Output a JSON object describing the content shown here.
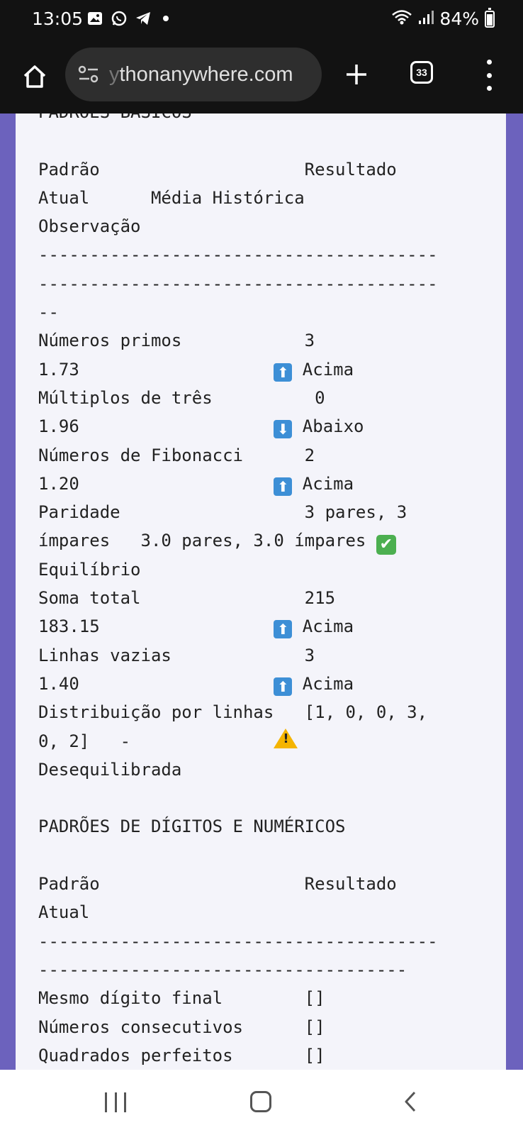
{
  "status_bar": {
    "time": "13:05",
    "battery": "84%",
    "battery_level": 0.84
  },
  "browser": {
    "url": "thonanywhere.com",
    "url_prefix_fragment": "y",
    "tab_count": "33"
  },
  "report": {
    "cut_header": "PADRÕES BÁSICOS",
    "section1_header": [
      "Padrão                    Resultado",
      "Atual      Média Histórica",
      "Observação"
    ],
    "divider_a": "---------------------------------------",
    "divider_b": "---------------------------------------",
    "divider_c": "--",
    "rows": [
      {
        "line1": "Números primos            3",
        "line2_pre": "1.73                   ",
        "arrow": "up",
        "line2_post": " Acima"
      },
      {
        "line1": "Múltiplos de três          0",
        "line2_pre": "1.96                   ",
        "arrow": "down",
        "line2_post": " Abaixo"
      },
      {
        "line1": "Números de Fibonacci      2",
        "line2_pre": "1.20                   ",
        "arrow": "up",
        "line2_post": " Acima"
      }
    ],
    "paridade": {
      "line1": "Paridade                  3 pares, 3",
      "line2": "ímpares   3.0 pares, 3.0 ímpares ",
      "line3": "Equilíbrio"
    },
    "rows2": [
      {
        "line1": "Soma total                215",
        "line2_pre": "183.15                 ",
        "arrow": "up",
        "line2_post": " Acima"
      },
      {
        "line1": "Linhas vazias             3",
        "line2_pre": "1.40                   ",
        "arrow": "up",
        "line2_post": " Acima"
      }
    ],
    "distribuicao": {
      "line1": "Distribuição por linhas   [1, 0, 0, 3,",
      "line2": "0, 2]   -              ",
      "line3": "Desequilibrada"
    },
    "section2_title": "PADRÕES DE DÍGITOS E NUMÉRICOS",
    "section2_header": [
      "Padrão                    Resultado",
      "Atual"
    ],
    "divider_d": "---------------------------------------",
    "divider_e": "------------------------------------",
    "digit_rows": [
      "Mesmo dígito final        []",
      "Números consecutivos      []",
      "Quadrados perfeitos       []"
    ]
  },
  "icons": {
    "up_arrow": "⬆",
    "down_arrow": "⬇",
    "check": "✔",
    "warning_mark": "!"
  },
  "colors": {
    "page_background": "#6c62bd",
    "content_background": "#f4f4fa",
    "arrow_emoji": "#3d8fd6",
    "check_emoji": "#4caf50",
    "warning_emoji": "#f4b400"
  }
}
